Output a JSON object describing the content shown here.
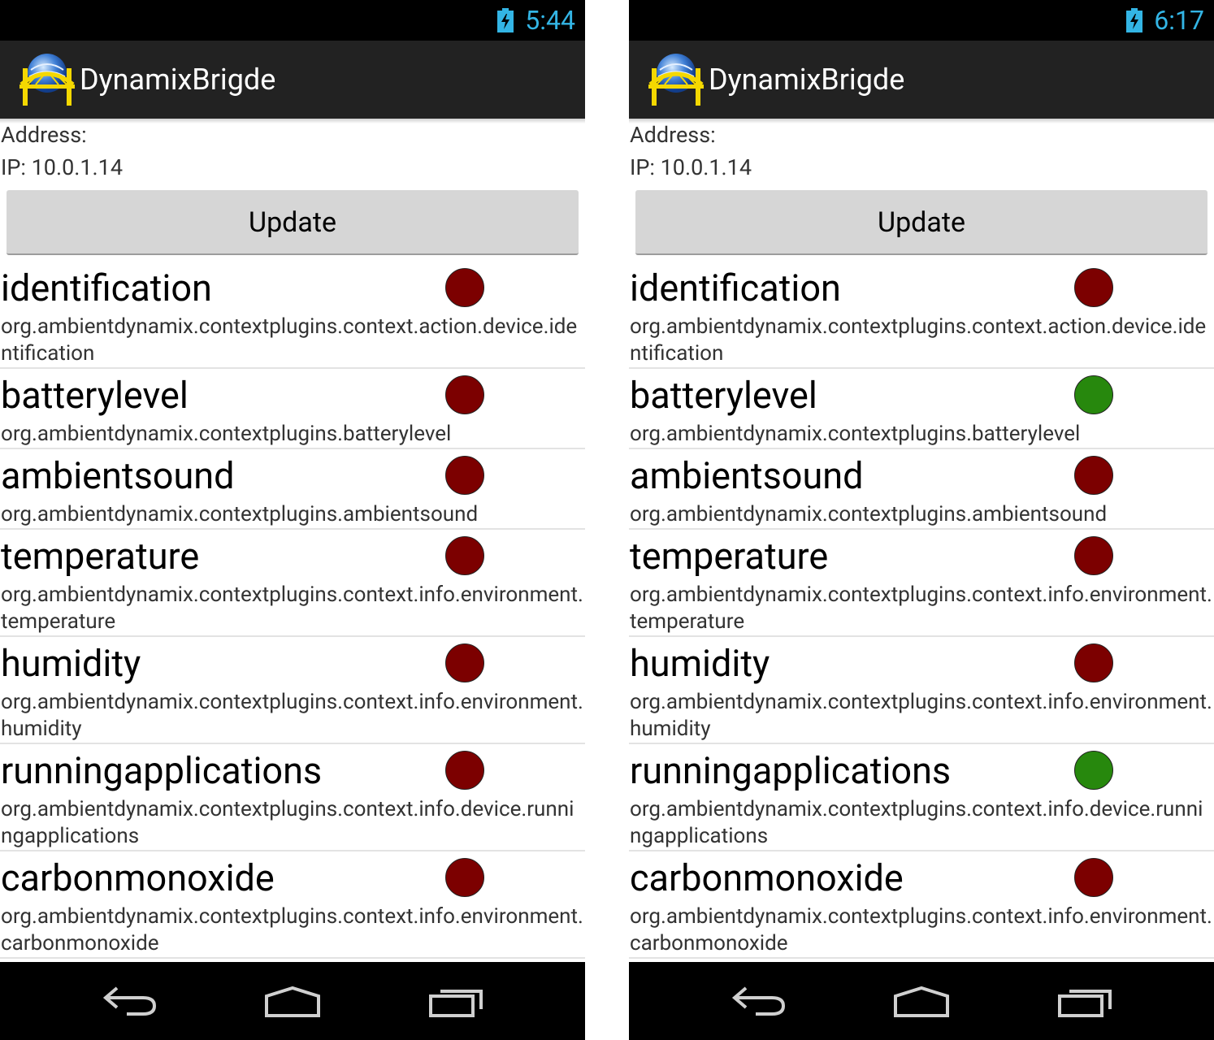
{
  "screens": [
    {
      "status_time": "5:44",
      "app_title": "DynamixBrigde",
      "address_label": "Address:",
      "ip_text": "IP: 10.0.1.14",
      "update_label": "Update",
      "plugins": [
        {
          "name": "identification",
          "package": "org.ambientdynamix.contextplugins.context.action.device.identification",
          "status": "red"
        },
        {
          "name": "batterylevel",
          "package": "org.ambientdynamix.contextplugins.batterylevel",
          "status": "red"
        },
        {
          "name": "ambientsound",
          "package": "org.ambientdynamix.contextplugins.ambientsound",
          "status": "red"
        },
        {
          "name": "temperature",
          "package": "org.ambientdynamix.contextplugins.context.info.environment.temperature",
          "status": "red"
        },
        {
          "name": "humidity",
          "package": "org.ambientdynamix.contextplugins.context.info.environment.humidity",
          "status": "red"
        },
        {
          "name": "runningapplications",
          "package": "org.ambientdynamix.contextplugins.context.info.device.runningapplications",
          "status": "red"
        },
        {
          "name": "carbonmonoxide",
          "package": "org.ambientdynamix.contextplugins.context.info.environment.carbonmonoxide",
          "status": "red"
        }
      ]
    },
    {
      "status_time": "6:17",
      "app_title": "DynamixBrigde",
      "address_label": "Address:",
      "ip_text": "IP: 10.0.1.14",
      "update_label": "Update",
      "plugins": [
        {
          "name": "identification",
          "package": "org.ambientdynamix.contextplugins.context.action.device.identification",
          "status": "red"
        },
        {
          "name": "batterylevel",
          "package": "org.ambientdynamix.contextplugins.batterylevel",
          "status": "green"
        },
        {
          "name": "ambientsound",
          "package": "org.ambientdynamix.contextplugins.ambientsound",
          "status": "red"
        },
        {
          "name": "temperature",
          "package": "org.ambientdynamix.contextplugins.context.info.environment.temperature",
          "status": "red"
        },
        {
          "name": "humidity",
          "package": "org.ambientdynamix.contextplugins.context.info.environment.humidity",
          "status": "red"
        },
        {
          "name": "runningapplications",
          "package": "org.ambientdynamix.contextplugins.context.info.device.runningapplications",
          "status": "green"
        },
        {
          "name": "carbonmonoxide",
          "package": "org.ambientdynamix.contextplugins.context.info.environment.carbonmonoxide",
          "status": "red"
        }
      ]
    }
  ],
  "colors": {
    "accent": "#33b5e5",
    "status_red": "#7c0000",
    "status_green": "#27880d",
    "action_bar": "#222222"
  },
  "icons": {
    "battery": "battery-charging-icon",
    "app": "bridge-globe-icon",
    "back": "back-icon",
    "home": "home-icon",
    "recents": "recents-icon"
  }
}
